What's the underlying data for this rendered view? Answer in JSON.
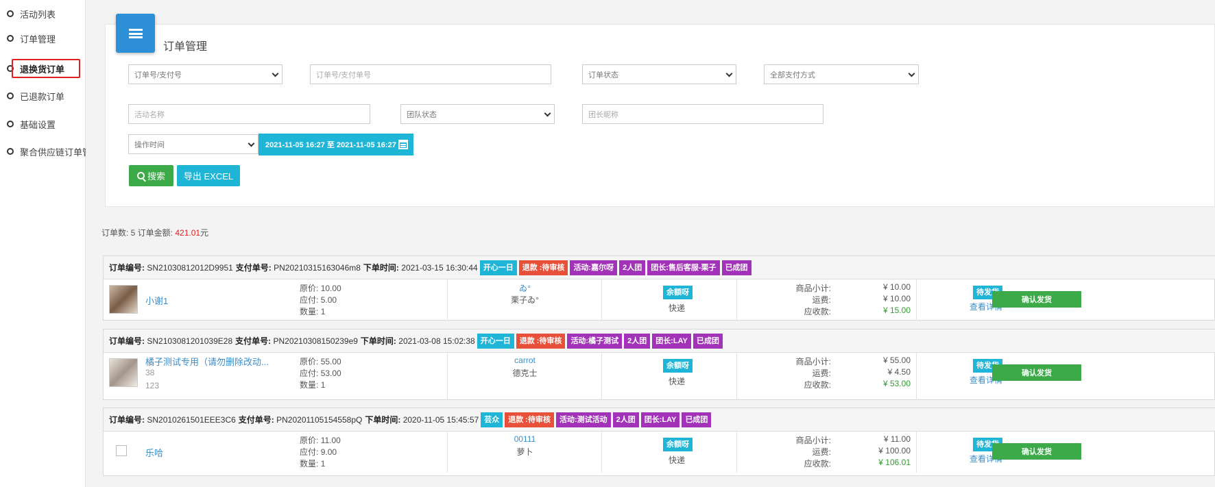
{
  "sidebar": {
    "items": [
      {
        "label": "活动列表"
      },
      {
        "label": "订单管理"
      },
      {
        "label": "退换货订单"
      },
      {
        "label": "已退款订单"
      },
      {
        "label": "基础设置"
      },
      {
        "label": "聚合供应链订单管"
      }
    ]
  },
  "header": {
    "title": "订单管理"
  },
  "filters": {
    "order_type_select": "订单号/支付号",
    "order_no_placeholder": "订单号/支付单号",
    "order_status_select": "订单状态",
    "pay_method_select": "全部支付方式",
    "activity_name_placeholder": "活动名称",
    "team_status_select": "团队状态",
    "leader_name_placeholder": "团长昵称",
    "time_type_select": "操作时间",
    "date_range": "2021-11-05 16:27 至 2021-11-05 16:27",
    "search_label": "搜索",
    "export_label": "导出 EXCEL"
  },
  "summary": {
    "prefix": "订单数: 5 订单金额: ",
    "amount": "421.01",
    "suffix": "元"
  },
  "labels": {
    "order_no": "订单编号:",
    "pay_no": "支付单号:",
    "order_time": "下单时间:",
    "orig_price": "原价:",
    "payable": "应付:",
    "quantity": "数量:",
    "subtotal": "商品小计:",
    "shipping": "运费:",
    "receivable": "应收款:",
    "view_detail": "查看详情",
    "confirm_ship": "确认发货"
  },
  "orders": [
    {
      "order_no": "SN21030812012D9951",
      "pay_no": "PN20210315163046m8",
      "time": "2021-03-15 16:30:44",
      "tags": [
        {
          "text": "开心一日",
          "color": "cyan"
        },
        {
          "text": "退款 :待审核",
          "color": "red"
        },
        {
          "text": "活动:嘉尔呀",
          "color": "purple"
        },
        {
          "text": "2人团",
          "color": "purple"
        },
        {
          "text": "团长:售后客服-栗子",
          "color": "purple"
        },
        {
          "text": "已成团",
          "color": "purple"
        }
      ],
      "product": "小谢1",
      "orig": "10.00",
      "pay": "5.00",
      "qty": "1",
      "buyer_link": "ゐ°",
      "buyer_name": "栗子ゐ°",
      "pay_method": "余额呀",
      "ship_method": "快递",
      "subtotal": "¥ 10.00",
      "freight": "¥ 10.00",
      "total": "¥ 15.00",
      "status": "待发货"
    },
    {
      "order_no": "SN2103081201039E28",
      "pay_no": "PN20210308150239e9",
      "time": "2021-03-08 15:02:38",
      "tags": [
        {
          "text": "开心一日",
          "color": "cyan"
        },
        {
          "text": "退款 :待审核",
          "color": "red"
        },
        {
          "text": "活动:橘子测试",
          "color": "purple"
        },
        {
          "text": "2人团",
          "color": "purple"
        },
        {
          "text": "团长:LAY",
          "color": "purple"
        },
        {
          "text": "已成团",
          "color": "purple"
        }
      ],
      "product": "橘子测试专用（请勿删除改动...",
      "meta1": "38",
      "meta2": "123",
      "orig": "55.00",
      "pay": "53.00",
      "qty": "1",
      "buyer_link": "carrot",
      "buyer_name": "德克士",
      "pay_method": "余额呀",
      "ship_method": "快递",
      "subtotal": "¥ 55.00",
      "freight": "¥ 4.50",
      "total": "¥ 53.00",
      "status": "待发货"
    },
    {
      "order_no": "SN2010261501EEE3C6",
      "pay_no": "PN20201105154558pQ",
      "time": "2020-11-05 15:45:57",
      "tags": [
        {
          "text": "芸众",
          "color": "cyan"
        },
        {
          "text": "退款 :待审核",
          "color": "red"
        },
        {
          "text": "活动:测试活动",
          "color": "purple"
        },
        {
          "text": "2人团",
          "color": "purple"
        },
        {
          "text": "团长:LAY",
          "color": "purple"
        },
        {
          "text": "已成团",
          "color": "purple"
        }
      ],
      "product": "乐哈",
      "orig": "11.00",
      "pay": "9.00",
      "qty": "1",
      "buyer_link": "00111",
      "buyer_name": "萝卜",
      "pay_method": "余额呀",
      "ship_method": "快递",
      "subtotal": "¥ 11.00",
      "freight": "¥ 100.00",
      "total": "¥ 106.01",
      "status": "待发货"
    }
  ]
}
